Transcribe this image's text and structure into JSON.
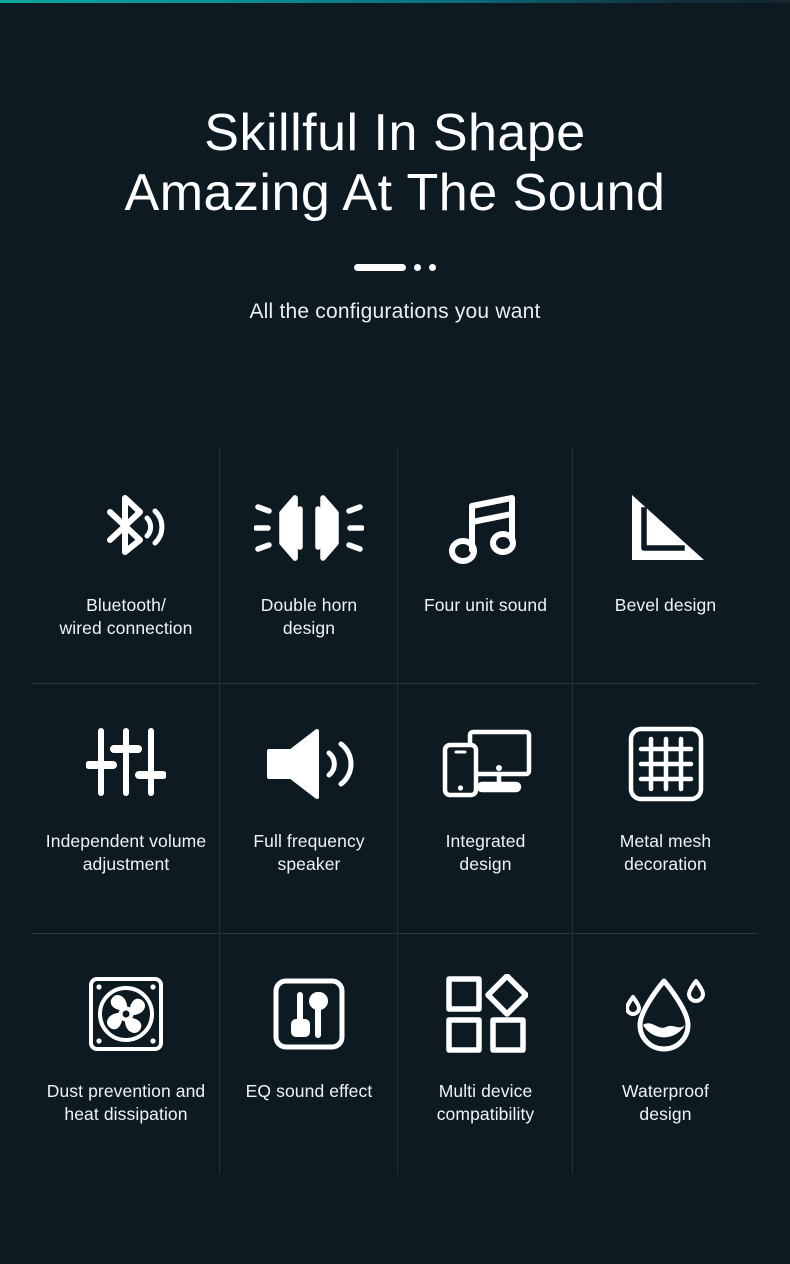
{
  "accent_color": "#0aa89c",
  "background_color": "#0d1a22",
  "text_color": "#ffffff",
  "divider_color": "#2b3841",
  "hero": {
    "title_line_1": "Skillful In Shape",
    "title_line_2": "Amazing At The Sound",
    "subtitle": "All the configurations you want",
    "ornament": {
      "bar_label": "divider-bar",
      "dot_count": 2
    }
  },
  "features": [
    {
      "icon": "bluetooth-wireless-icon",
      "label": "Bluetooth/\nwired connection"
    },
    {
      "icon": "double-horn-speaker-icon",
      "label": "Double horn\ndesign"
    },
    {
      "icon": "music-note-icon",
      "label": "Four unit sound"
    },
    {
      "icon": "bevel-triangle-icon",
      "label": "Bevel design"
    },
    {
      "icon": "volume-sliders-icon",
      "label": "Independent volume\nadjustment"
    },
    {
      "icon": "speaker-waves-icon",
      "label": "Full frequency\nspeaker"
    },
    {
      "icon": "monitor-phone-icon",
      "label": "Integrated\ndesign"
    },
    {
      "icon": "metal-mesh-grid-icon",
      "label": "Metal mesh\ndecoration"
    },
    {
      "icon": "cooling-fan-icon",
      "label": "Dust prevention and\nheat dissipation"
    },
    {
      "icon": "eq-equalizer-icon",
      "label": "EQ sound effect"
    },
    {
      "icon": "multi-shapes-icon",
      "label": "Multi device\ncompatibility"
    },
    {
      "icon": "water-droplet-icon",
      "label": "Waterproof\ndesign"
    }
  ]
}
